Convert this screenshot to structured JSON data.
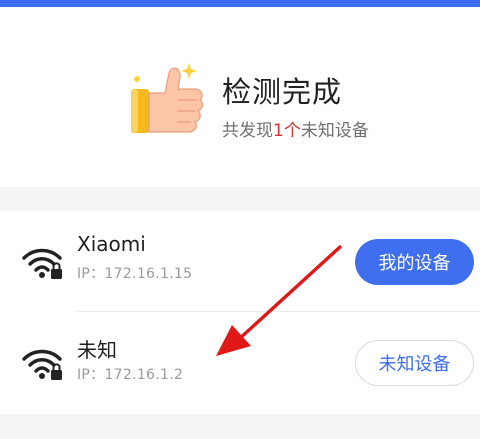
{
  "header": {
    "accent_color": "#3d6ef2"
  },
  "result": {
    "title": "检测完成",
    "subtitle_prefix": "共发现",
    "count": "1个",
    "subtitle_suffix": "未知设备",
    "icon": "thumbs-up-icon"
  },
  "devices": [
    {
      "name": "Xiaomi",
      "ip": "IP：172.16.1.15",
      "icon": "wifi-locked-icon",
      "button": "我的设备",
      "button_style": "primary"
    },
    {
      "name": "未知",
      "ip": "IP：172.16.1.2",
      "icon": "wifi-locked-icon",
      "button": "未知设备",
      "button_style": "outline"
    }
  ],
  "colors": {
    "primary": "#3f6fee",
    "count_highlight": "#e0302c",
    "annotation_arrow": "#e01818"
  }
}
